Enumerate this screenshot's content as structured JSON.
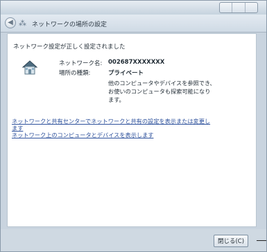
{
  "window": {
    "title": "ネットワークの場所の設定"
  },
  "content": {
    "status_message": "ネットワーク設定が正しく設定されました",
    "network_name_label": "ネットワーク名:",
    "network_name_value": "002687XXXXXXX",
    "location_type_label": "場所の種類:",
    "location_type_value": "プライベート",
    "description": "他のコンピュータやデバイスを参照でき、お使いのコンピュータも探索可能になります。",
    "link_sharing_center_line1": "ネットワークと共有センターでネットワークと共有の設定を表示または変更し",
    "link_sharing_center_line2": "ます",
    "link_view_devices": "ネットワーク上のコンピュータとデバイスを表示します"
  },
  "footer": {
    "close_label": "閉じる(C)"
  },
  "icons": {
    "back": "back-arrow-icon",
    "network": "network-icon",
    "house": "house-icon"
  }
}
